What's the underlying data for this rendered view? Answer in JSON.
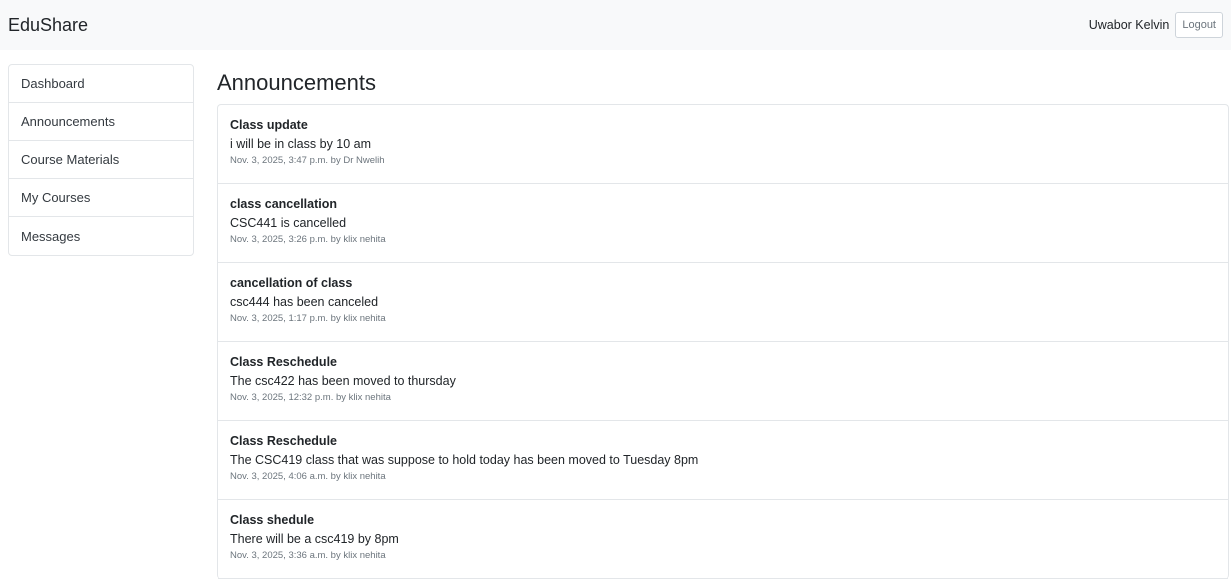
{
  "navbar": {
    "brand": "EduShare",
    "user_name": "Uwabor Kelvin",
    "logout_label": "Logout"
  },
  "sidebar": {
    "items": [
      {
        "label": "Dashboard"
      },
      {
        "label": "Announcements"
      },
      {
        "label": "Course Materials"
      },
      {
        "label": "My Courses"
      },
      {
        "label": "Messages"
      }
    ]
  },
  "main": {
    "title": "Announcements",
    "announcements": [
      {
        "title": "Class update",
        "body": "i will be in class by 10 am",
        "meta": "Nov. 3, 2025, 3:47 p.m. by Dr Nwelih"
      },
      {
        "title": "class cancellation",
        "body": "CSC441 is cancelled",
        "meta": "Nov. 3, 2025, 3:26 p.m. by klix nehita"
      },
      {
        "title": "cancellation of class",
        "body": "csc444 has been canceled",
        "meta": "Nov. 3, 2025, 1:17 p.m. by klix nehita"
      },
      {
        "title": "Class Reschedule",
        "body": "The csc422 has been moved to thursday",
        "meta": "Nov. 3, 2025, 12:32 p.m. by klix nehita"
      },
      {
        "title": "Class Reschedule",
        "body": "The CSC419 class that was suppose to hold today has been moved to Tuesday 8pm",
        "meta": "Nov. 3, 2025, 4:06 a.m. by klix nehita"
      },
      {
        "title": "Class shedule",
        "body": "There will be a csc419 by 8pm",
        "meta": "Nov. 3, 2025, 3:36 a.m. by klix nehita"
      }
    ]
  }
}
